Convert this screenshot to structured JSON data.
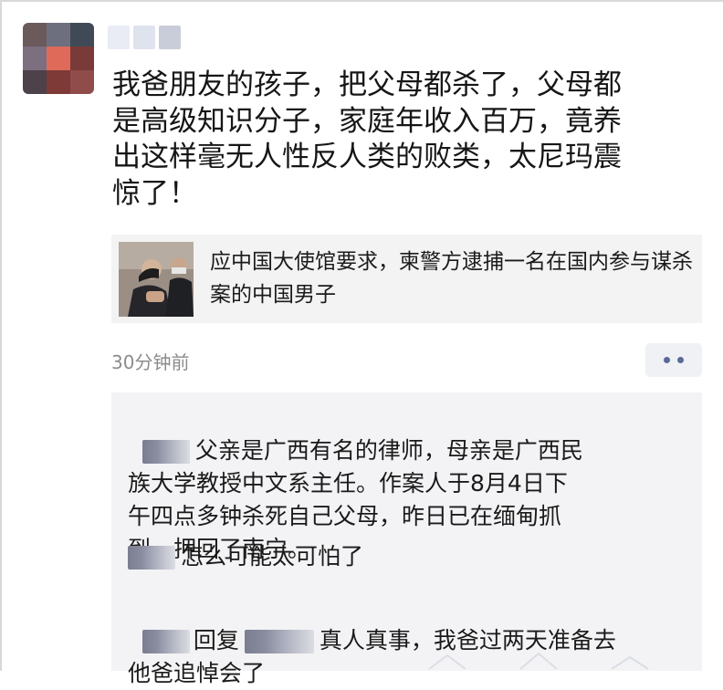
{
  "post": {
    "text": "我爸朋友的孩子，把父母都杀了，父母都\n是高级知识分子，家庭年收入百万，竟养\n出这样毫无人性反人类的败类，太尼玛震\n惊了！",
    "timestamp": "30分钟前"
  },
  "link_card": {
    "title": "应中国大使馆要求，柬警方逮捕一名在国内参与谋杀案的中国男子"
  },
  "comments": [
    {
      "text": "父亲是广西有名的律师，母亲是广西民\n族大学教授中文系主任。作案人于8月4日下\n午四点多钟杀死自己父母，昨日已在缅甸抓\n到，押回了南宁。"
    },
    {
      "text": "怎么可能太可怕了"
    },
    {
      "reply_word": "回复",
      "text": "真人真事，我爸过两天准备去\n他爸追悼会了"
    }
  ],
  "colors": {
    "link_blue": "#576b95",
    "card_bg": "#f3f3f3",
    "comments_bg": "#f3f3f5",
    "timestamp_gray": "#8c8c8c"
  },
  "icons": {
    "more": "more-dots-icon",
    "avatar": "avatar-pixelated"
  }
}
